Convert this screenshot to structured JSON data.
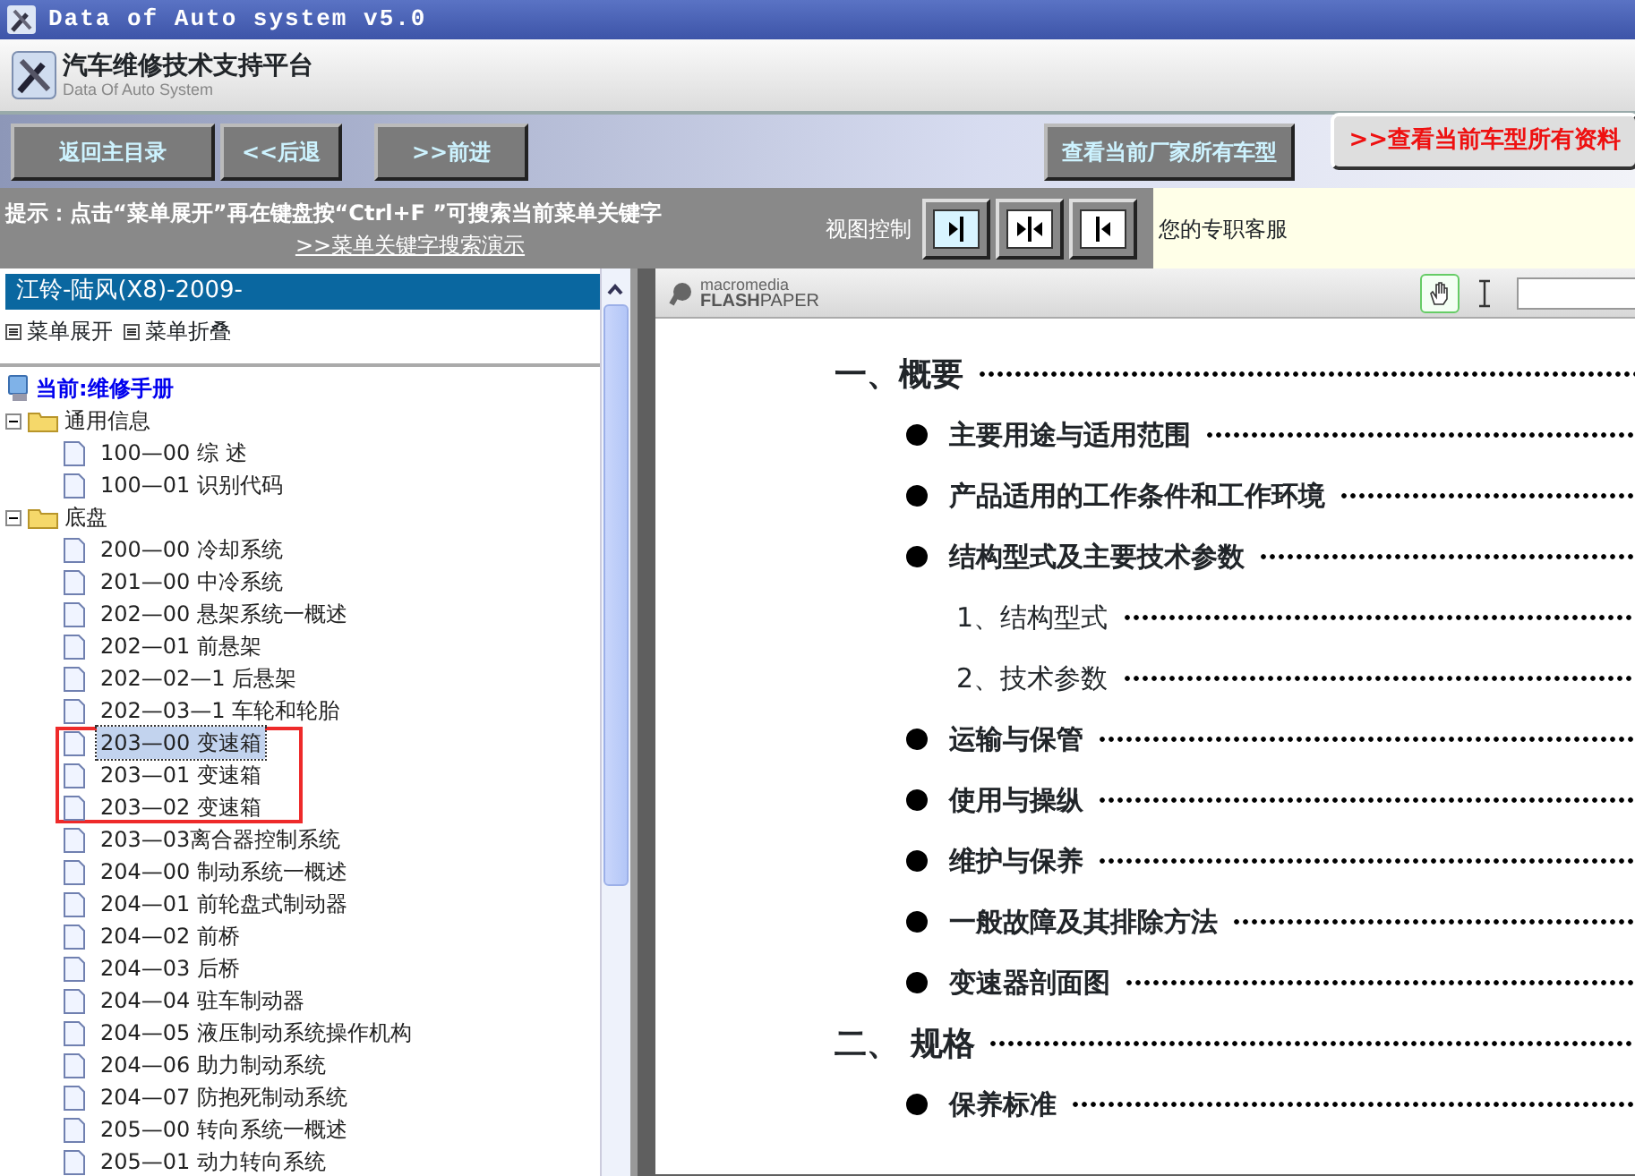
{
  "window": {
    "title": "Data of Auto system v5.0"
  },
  "header": {
    "title": "汽车维修技术支持平台",
    "subtitle": "Data Of Auto System"
  },
  "toolbar": {
    "left_buttons": [
      "返回主目录",
      "<<后退",
      ">>前进"
    ],
    "right_buttons": [
      {
        "label": "查看当前厂家所有车型",
        "kind": "plain"
      },
      {
        "label": ">>查看当前车型所有资料",
        "kind": "alert"
      }
    ]
  },
  "hint": {
    "text": "提示：点击“菜单展开”再在键盘按“Ctrl+F ”可搜索当前菜单关键字",
    "link": ">>菜单关键字搜索演示",
    "view_label": "视图控制",
    "service_text": "您的专职客服"
  },
  "sidebar": {
    "vehicle": "江铃-陆风(X8)-2009-",
    "actions": [
      "菜单展开",
      "菜单折叠"
    ],
    "root": "当前:维修手册",
    "tree": [
      {
        "label": "通用信息",
        "expanded": true,
        "children": [
          {
            "label": "100—00 综  述",
            "selected": false,
            "marked": false
          },
          {
            "label": "100—01 识别代码",
            "selected": false,
            "marked": false
          }
        ]
      },
      {
        "label": "底盘",
        "expanded": true,
        "children": [
          {
            "label": "200—00 冷却系统",
            "selected": false,
            "marked": false
          },
          {
            "label": "201—00 中冷系统",
            "selected": false,
            "marked": false
          },
          {
            "label": "202—00 悬架系统一概述",
            "selected": false,
            "marked": false
          },
          {
            "label": "202—01 前悬架",
            "selected": false,
            "marked": false
          },
          {
            "label": "202—02—1 后悬架",
            "selected": false,
            "marked": false
          },
          {
            "label": "202—03—1 车轮和轮胎",
            "selected": false,
            "marked": false
          },
          {
            "label": "203—00 变速箱",
            "selected": true,
            "marked": true
          },
          {
            "label": "203—01 变速箱",
            "selected": false,
            "marked": true
          },
          {
            "label": "203—02 变速箱",
            "selected": false,
            "marked": true
          },
          {
            "label": "203—03离合器控制系统",
            "selected": false,
            "marked": false
          },
          {
            "label": "204—00 制动系统一概述",
            "selected": false,
            "marked": false
          },
          {
            "label": "204—01 前轮盘式制动器",
            "selected": false,
            "marked": false
          },
          {
            "label": "204—02 前桥",
            "selected": false,
            "marked": false
          },
          {
            "label": "204—03 后桥",
            "selected": false,
            "marked": false
          },
          {
            "label": "204—04 驻车制动器",
            "selected": false,
            "marked": false
          },
          {
            "label": "204—05 液压制动系统操作机构",
            "selected": false,
            "marked": false
          },
          {
            "label": "204—06 助力制动系统",
            "selected": false,
            "marked": false
          },
          {
            "label": "204—07 防抱死制动系统",
            "selected": false,
            "marked": false
          },
          {
            "label": "205—00 转向系统一概述",
            "selected": false,
            "marked": false
          },
          {
            "label": "205—01 动力转向系统",
            "selected": false,
            "marked": false
          }
        ]
      }
    ]
  },
  "viewer": {
    "brand_top": "macromedia",
    "brand_bold": "FLASH",
    "brand_light": "PAPER",
    "hand_tool_selected": true,
    "lines": [
      {
        "kind": "heading",
        "text": "一、概要"
      },
      {
        "kind": "bullet",
        "text": "主要用途与适用范围"
      },
      {
        "kind": "bullet",
        "text": "产品适用的工作条件和工作环境"
      },
      {
        "kind": "bullet",
        "text": "结构型式及主要技术参数"
      },
      {
        "kind": "sub",
        "text": "1、结构型式"
      },
      {
        "kind": "sub",
        "text": "2、技术参数"
      },
      {
        "kind": "bullet",
        "text": "运输与保管"
      },
      {
        "kind": "bullet",
        "text": "使用与操纵"
      },
      {
        "kind": "bullet",
        "text": "维护与保养"
      },
      {
        "kind": "bullet",
        "text": "一般故障及其排除方法"
      },
      {
        "kind": "bullet",
        "text": "变速器剖面图"
      },
      {
        "kind": "heading",
        "text": "二、 规格"
      },
      {
        "kind": "bullet",
        "text": "保养标准"
      }
    ]
  }
}
